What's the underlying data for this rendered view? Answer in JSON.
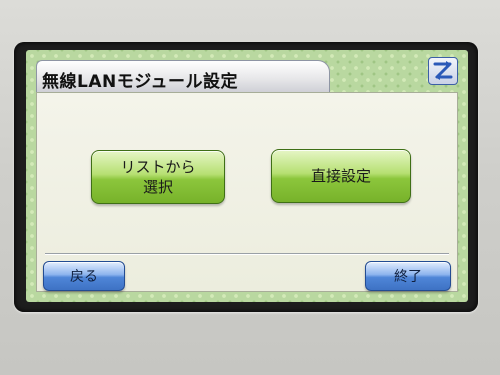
{
  "window": {
    "title": "無線LANモジュール設定"
  },
  "header": {
    "corner_icon": "z-switch-icon",
    "corner_color": "#2b59b8"
  },
  "main": {
    "select_from_list_label": "リストから\n選択",
    "direct_setting_label": "直接設定"
  },
  "footer": {
    "back_label": "戻る",
    "end_label": "終了"
  },
  "colors": {
    "primary_green": "#8cc63c",
    "secondary_blue": "#4f86d8",
    "screen_pattern": "#b9d8a0"
  }
}
